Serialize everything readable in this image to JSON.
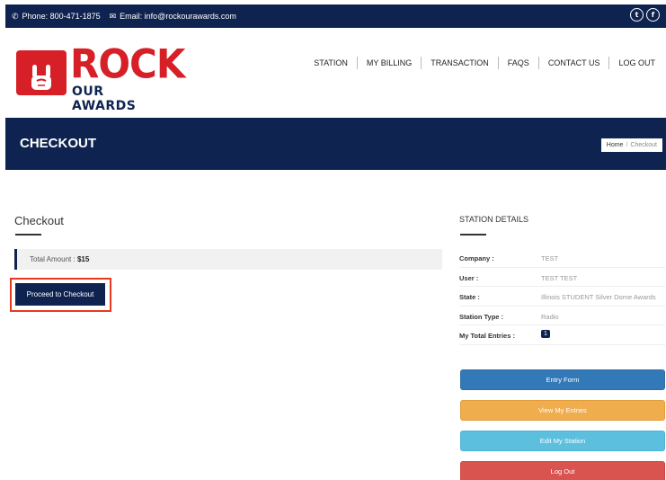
{
  "topbar": {
    "phone": "Phone: 800-471-1875",
    "email": "Email: info@rockourawards.com",
    "social": [
      "twitter-icon",
      "facebook-icon"
    ]
  },
  "logo": {
    "line1": "ROCK",
    "line2": "OUR AWARDS"
  },
  "nav": {
    "items": [
      "STATION",
      "MY BILLING",
      "TRANSACTION",
      "FAQS",
      "CONTACT US",
      "LOG OUT"
    ]
  },
  "band": {
    "title": "CHECKOUT",
    "breadcrumb": {
      "home": "Home",
      "separator": "/",
      "current": "Checkout"
    }
  },
  "checkout": {
    "title": "Checkout",
    "amount_label": "Total Amount :",
    "amount_value": "$15",
    "button": "Proceed to Checkout"
  },
  "station": {
    "title": "STATION DETAILS",
    "rows": [
      {
        "key": "Company :",
        "value": "TEST"
      },
      {
        "key": "User :",
        "value": "TEST TEST"
      },
      {
        "key": "State :",
        "value": "Illinois STUDENT Silver Dome Awards"
      },
      {
        "key": "Station Type :",
        "value": "Radio"
      },
      {
        "key": "My Total Entries :",
        "value": "1"
      }
    ],
    "buttons": {
      "entry_form": "Entry Form",
      "view_entries": "View My Entries",
      "edit_station": "Edit My Station",
      "log_out": "Log Out"
    }
  },
  "colors": {
    "navy": "#0f2350",
    "brand_red": "#d61f26",
    "highlight": "#e8391f",
    "btn_blue": "#3379b7",
    "btn_orange": "#efad4e",
    "btn_cyan": "#5cbfde",
    "btn_red": "#d9534f"
  }
}
